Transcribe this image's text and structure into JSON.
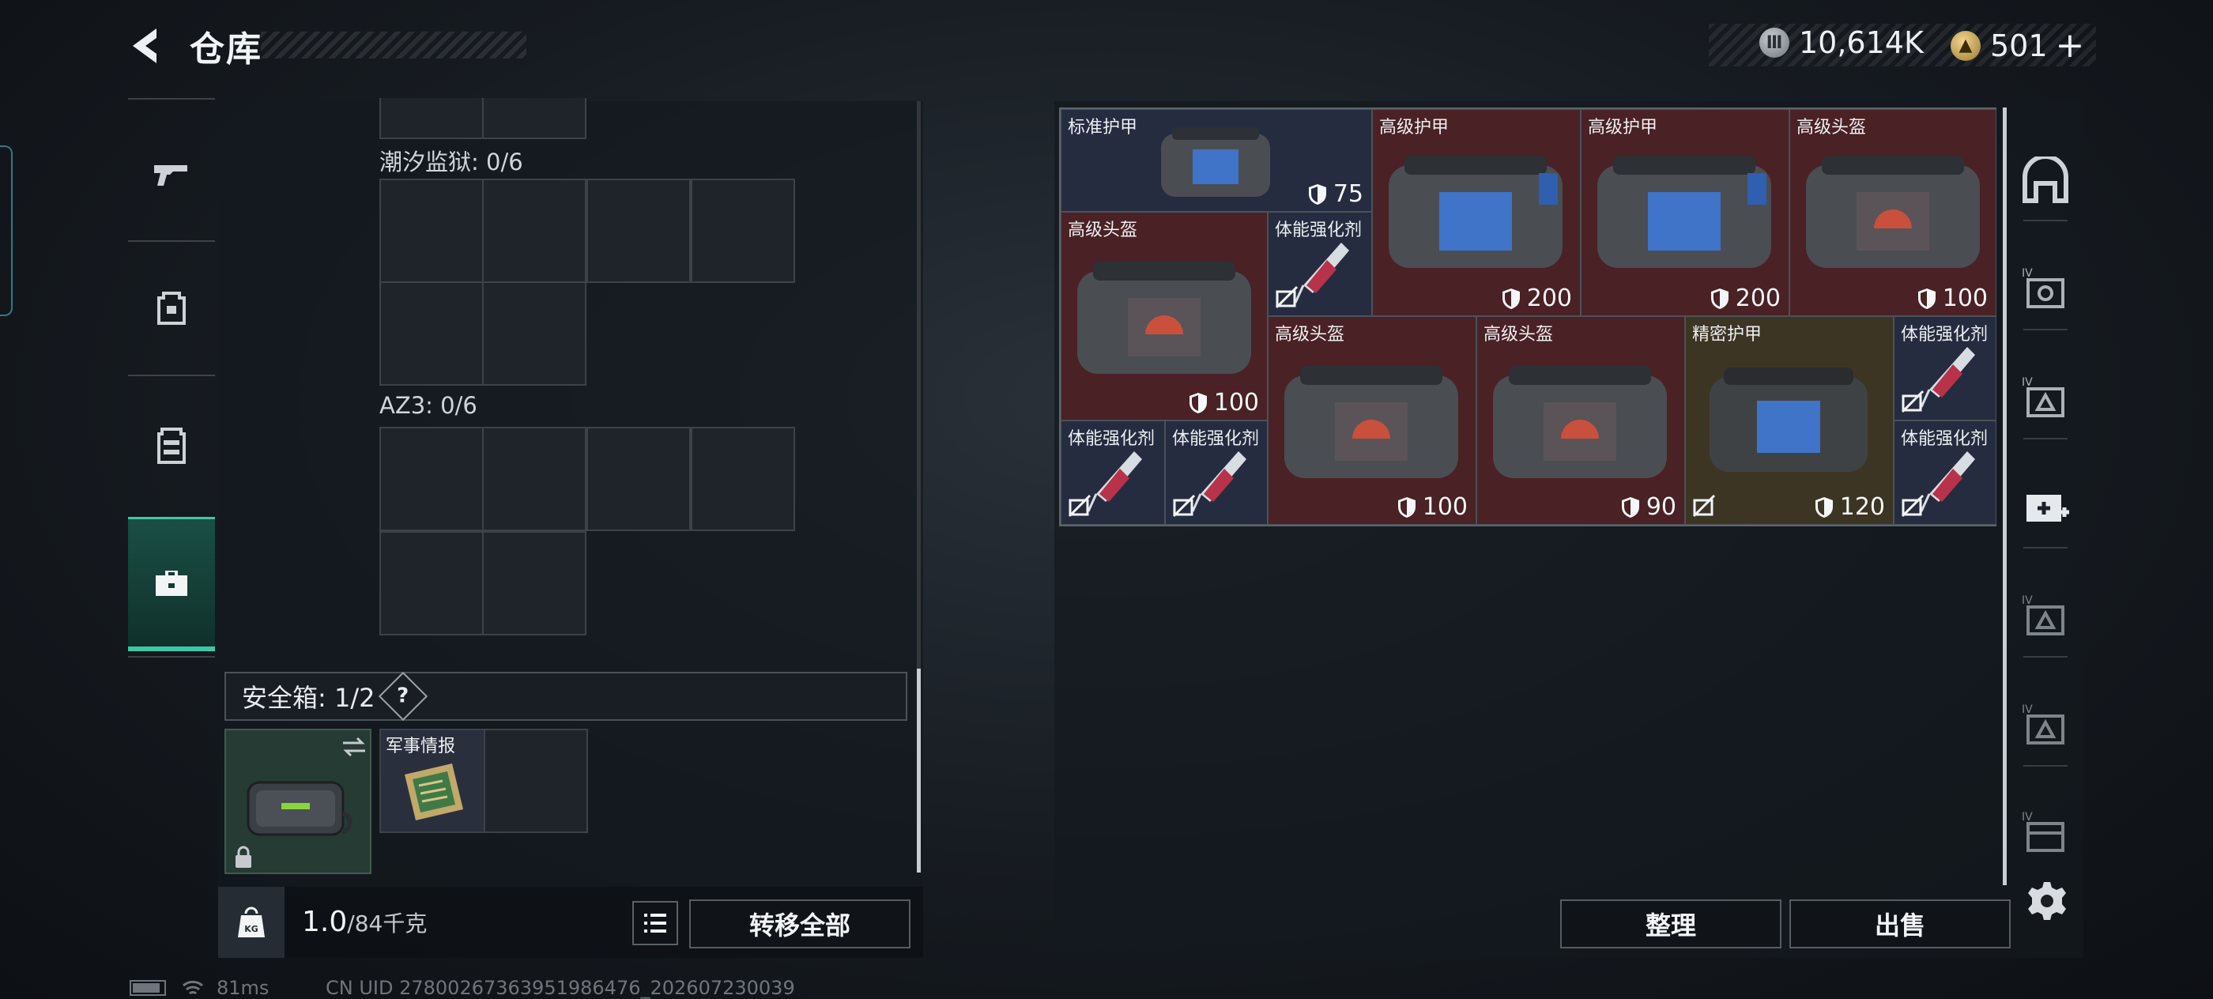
{
  "header": {
    "title": "仓库",
    "currency_primary": "10,614K",
    "currency_secondary": "501",
    "currency_add": "+"
  },
  "sidebar": {
    "items": [
      {
        "name": "weapon-icon"
      },
      {
        "name": "backpack-icon"
      },
      {
        "name": "vest-icon"
      },
      {
        "name": "case-icon",
        "active": true
      }
    ]
  },
  "left": {
    "section_partial_label": "",
    "section1_label": "潮汐监狱: 0/6",
    "section2_label": "AZ3: 0/6",
    "safebox_label": "安全箱: 1/2",
    "safebox_help": "?",
    "intel_item_name": "军事情报",
    "weight_value": "1.0",
    "weight_capacity": "/84千克",
    "transfer_all": "转移全部"
  },
  "inventory": {
    "items": [
      {
        "name": "标准护甲",
        "durability": "75",
        "color": "blue"
      },
      {
        "name": "高级护甲",
        "durability": "200",
        "color": "red"
      },
      {
        "name": "高级护甲",
        "durability": "200",
        "color": "red"
      },
      {
        "name": "高级头盔",
        "durability": "100",
        "color": "red"
      },
      {
        "name": "高级头盔",
        "durability": "100",
        "color": "red"
      },
      {
        "name": "体能强化剂",
        "color": "blue"
      },
      {
        "name": "高级头盔",
        "durability": "100",
        "color": "red"
      },
      {
        "name": "高级头盔",
        "durability": "90",
        "color": "red"
      },
      {
        "name": "精密护甲",
        "durability": "120",
        "color": "gold"
      },
      {
        "name": "体能强化剂",
        "color": "blue"
      },
      {
        "name": "体能强化剂",
        "color": "blue"
      },
      {
        "name": "体能强化剂",
        "color": "blue"
      },
      {
        "name": "体能强化剂",
        "color": "blue"
      }
    ]
  },
  "actions": {
    "sort": "整理",
    "sell": "出售"
  },
  "status": {
    "ping": "81ms",
    "uid": "CN UID 27800267363951986476_202607230039"
  },
  "colors": {
    "accent": "#3fc7a5",
    "rare_red": "#4a2125",
    "rare_blue": "#262c40",
    "rare_gold": "#3d3524"
  }
}
